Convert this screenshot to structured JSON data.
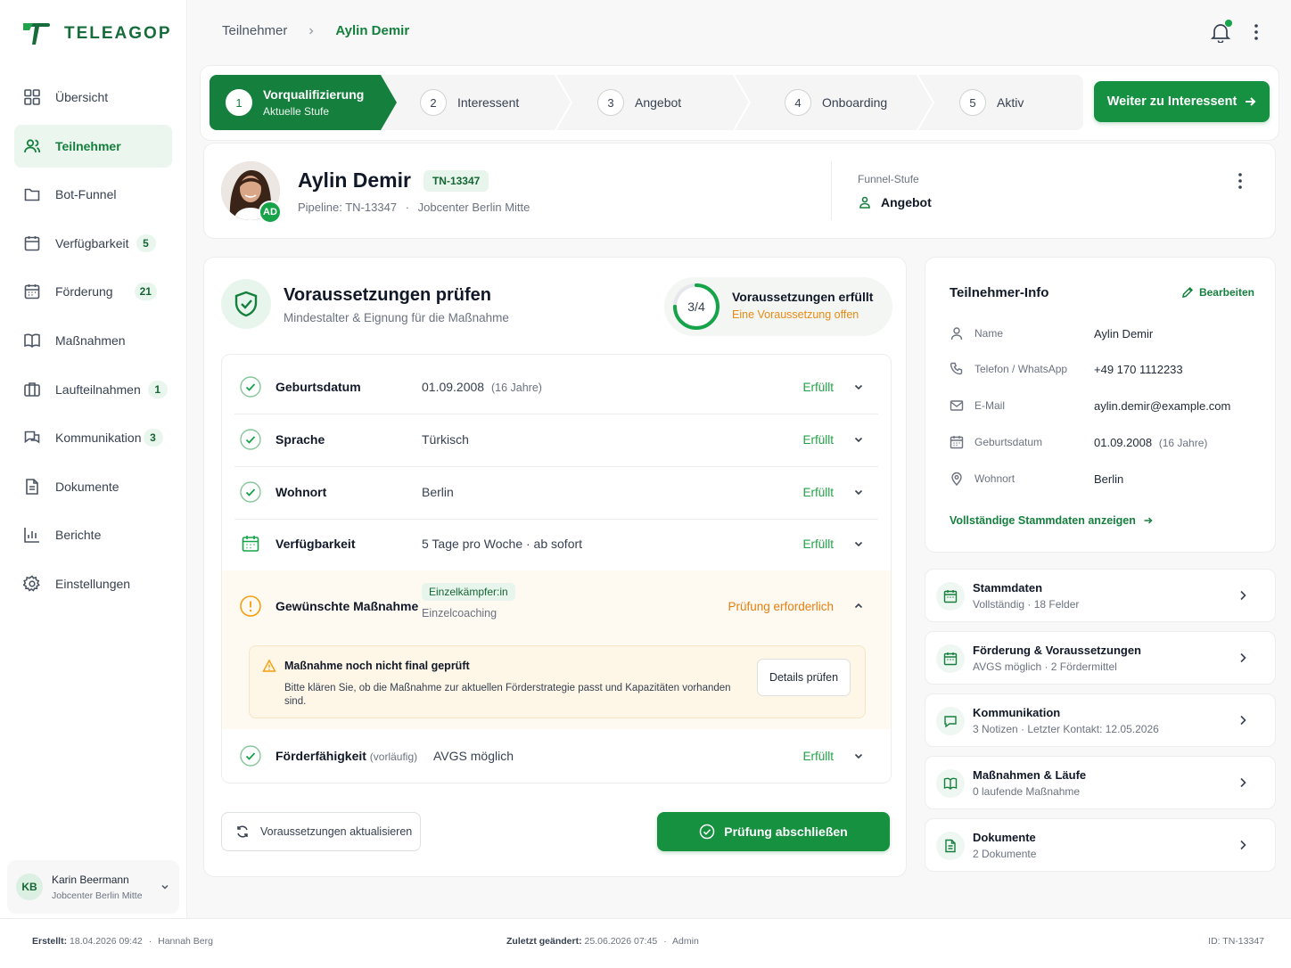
{
  "brand": {
    "name": "TELEAGOP",
    "accent": "#15803d"
  },
  "sidebar": {
    "items": [
      {
        "label": "Übersicht",
        "icon": "grid-icon"
      },
      {
        "label": "Teilnehmer",
        "icon": "users-icon",
        "active": true
      },
      {
        "label": "Bot-Funnel",
        "icon": "folder-icon"
      },
      {
        "label": "Verfügbarkeit",
        "icon": "calendar-icon",
        "badge": "5"
      },
      {
        "label": "Förderung",
        "icon": "calendar-grid-icon",
        "badge": "21"
      },
      {
        "label": "Maßnahmen",
        "icon": "book-icon"
      },
      {
        "label": "Laufteilnahmen",
        "icon": "columns-icon",
        "badge": "1"
      },
      {
        "label": "Kommunikation",
        "icon": "chat-icon",
        "badge": "3"
      },
      {
        "label": "Dokumente",
        "icon": "document-icon"
      },
      {
        "label": "Berichte",
        "icon": "bar-chart-icon"
      },
      {
        "label": "Einstellungen",
        "icon": "gear-icon"
      }
    ],
    "user": {
      "initials": "KB",
      "name": "Karin Beermann",
      "org": "Jobcenter Berlin Mitte"
    }
  },
  "breadcrumb": {
    "parent": "Teilnehmer",
    "current": "Aylin Demir"
  },
  "stepper": {
    "steps": [
      {
        "num": "1",
        "label": "Vorqualifizierung",
        "sub": "Aktuelle Stufe"
      },
      {
        "num": "2",
        "label": "Interessent"
      },
      {
        "num": "3",
        "label": "Angebot"
      },
      {
        "num": "4",
        "label": "Onboarding"
      },
      {
        "num": "5",
        "label": "Aktiv"
      }
    ],
    "next_button": "Weiter zu Interessent"
  },
  "profile": {
    "name": "Aylin Demir",
    "initials": "AD",
    "id_badge": "TN-13347",
    "pipeline": "Pipeline: TN-13347",
    "agency": "Jobcenter Berlin Mitte",
    "funnel_label": "Funnel-Stufe",
    "funnel_value": "Angebot"
  },
  "requirements": {
    "title": "Voraussetzungen prüfen",
    "subtitle": "Mindestalter & Eignung für die Maßnahme",
    "progress_label": "3/4",
    "progress_fraction": 0.75,
    "summary_title": "Voraussetzungen erfüllt",
    "summary_sub": "Eine Voraussetzung offen",
    "rows": [
      {
        "label": "Geburtsdatum",
        "value": "01.09.2008",
        "extra": "(16 Jahre)",
        "status": "Erfüllt"
      },
      {
        "label": "Sprache",
        "value": "Türkisch",
        "status": "Erfüllt"
      },
      {
        "label": "Wohnort",
        "value": "Berlin",
        "status": "Erfüllt"
      },
      {
        "label": "Verfügbarkeit",
        "value": "5 Tage pro Woche · ab sofort",
        "status": "Erfüllt"
      }
    ],
    "measure": {
      "label": "Gewünschte Maßnahme",
      "chip": "Einzelkämpfer:in",
      "sub": "Einzelcoaching",
      "status": "Prüfung erforderlich",
      "alert_title": "Maßnahme noch nicht final geprüft",
      "alert_text": "Bitte klären Sie, ob die Maßnahme zur aktuellen Förderstrategie passt und Kapazitäten vorhanden sind.",
      "alert_button": "Details prüfen"
    },
    "eligibility": {
      "label": "Förderfähigkeit",
      "qualifier": "(vorläufig)",
      "value": "AVGS möglich",
      "status": "Erfüllt"
    },
    "refresh_button": "Voraussetzungen aktualisieren",
    "finish_button": "Prüfung abschließen"
  },
  "info": {
    "title": "Teilnehmer-Info",
    "edit": "Bearbeiten",
    "rows": [
      {
        "icon": "person-icon",
        "label": "Name",
        "value": "Aylin Demir"
      },
      {
        "icon": "phone-icon",
        "label": "Telefon / WhatsApp",
        "value": "+49 170 1112233"
      },
      {
        "icon": "mail-icon",
        "label": "E-Mail",
        "value": "aylin.demir@example.com"
      },
      {
        "icon": "calendar-icon",
        "label": "Geburtsdatum",
        "value": "01.09.2008",
        "extra": "(16 Jahre)"
      },
      {
        "icon": "location-icon",
        "label": "Wohnort",
        "value": "Berlin"
      }
    ],
    "more_link": "Vollständige Stammdaten anzeigen"
  },
  "sections": [
    {
      "title": "Stammdaten",
      "sub": "Vollständig · 18 Felder",
      "icon": "calendar-icon"
    },
    {
      "title": "Förderung & Voraussetzungen",
      "sub": "AVGS möglich · 2 Fördermittel",
      "icon": "calendar-icon"
    },
    {
      "title": "Kommunikation",
      "sub": "3 Notizen · Letzter Kontakt: 12.05.2026",
      "icon": "chat-icon"
    },
    {
      "title": "Maßnahmen & Läufe",
      "sub": "0 laufende Maßnahme",
      "icon": "book-icon"
    },
    {
      "title": "Dokumente",
      "sub": "2 Dokumente",
      "icon": "document-icon"
    }
  ],
  "footer": {
    "created_label": "Erstellt:",
    "created_value": "18.04.2026 09:42",
    "created_by": "Hannah Berg",
    "changed_label": "Zuletzt geändert:",
    "changed_value": "25.06.2026 07:45",
    "changed_by": "Admin",
    "id": "ID: TN-13347"
  }
}
